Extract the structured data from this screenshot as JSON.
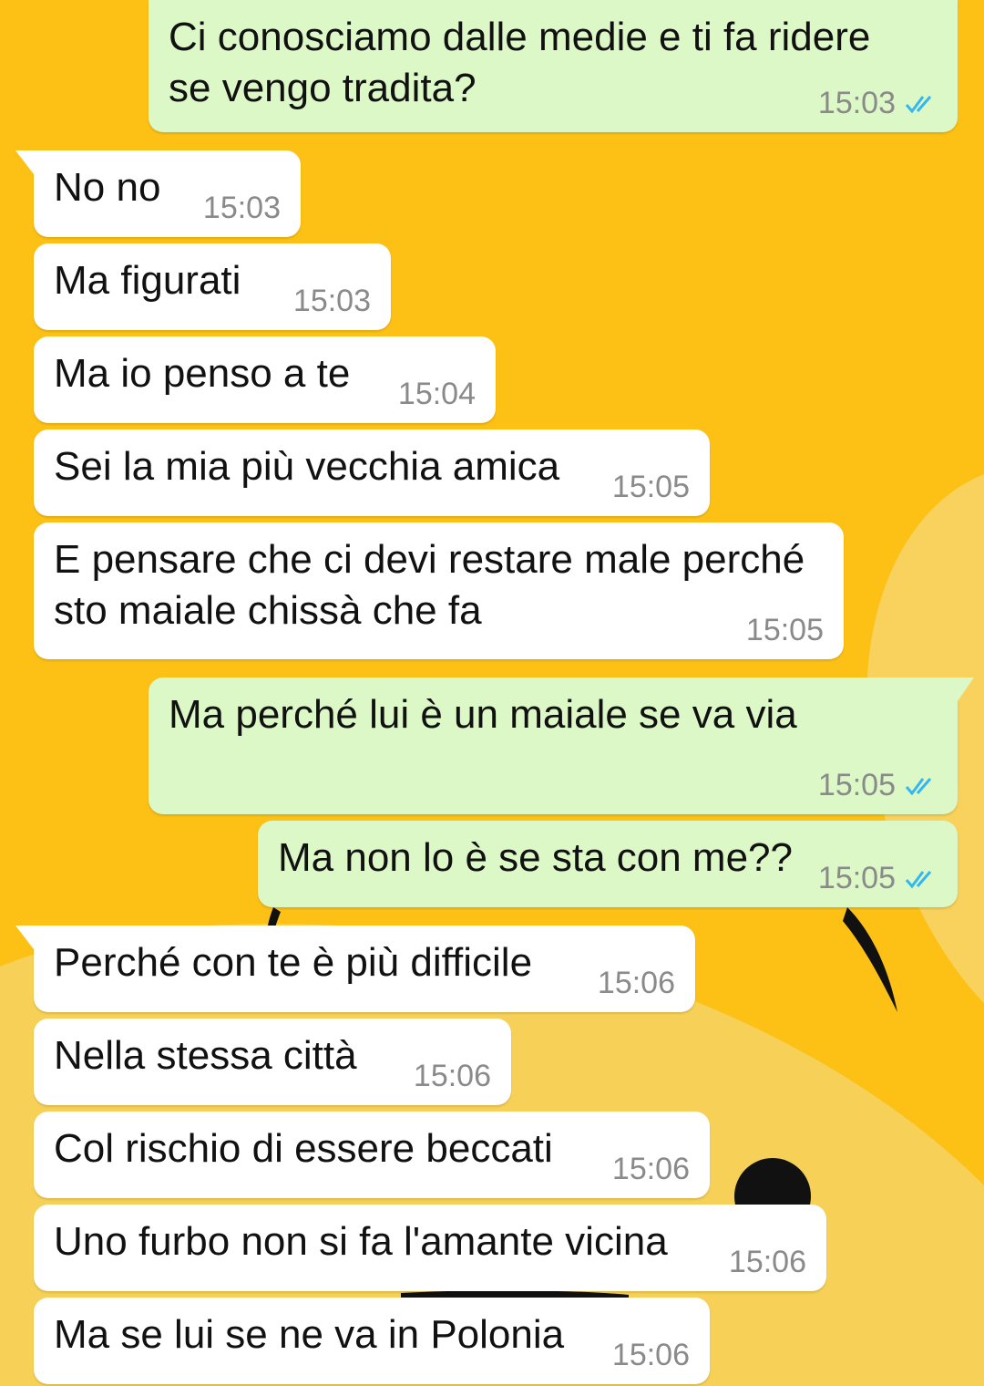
{
  "theme": {
    "wallpaper_color": "#FDC116",
    "wallpaper_light_color": "#F8D25C",
    "incoming_bubble_color": "#FFFFFF",
    "outgoing_bubble_color": "#DCF8C6",
    "timestamp_color": "#8A8A8A",
    "read_receipt_color": "#34B7F1"
  },
  "messages": [
    {
      "direction": "outgoing",
      "text": "Ci conosciamo dalle medie e ti fa ridere\nse vengo tradita?",
      "time": "15:03",
      "status_icon": "double-check-read-icon"
    },
    {
      "direction": "incoming",
      "text": "No no",
      "time": "15:03"
    },
    {
      "direction": "incoming",
      "text": "Ma figurati",
      "time": "15:03"
    },
    {
      "direction": "incoming",
      "text": "Ma io penso a te",
      "time": "15:04"
    },
    {
      "direction": "incoming",
      "text": "Sei la mia più vecchia amica",
      "time": "15:05"
    },
    {
      "direction": "incoming",
      "text": "E pensare che ci devi restare male perché\nsto maiale chissà che fa",
      "time": "15:05"
    },
    {
      "direction": "outgoing",
      "text": "Ma perché lui è un maiale se va via",
      "time": "15:05",
      "status_icon": "double-check-read-icon"
    },
    {
      "direction": "outgoing",
      "text": "Ma non lo è se sta con me??",
      "time": "15:05",
      "status_icon": "double-check-read-icon"
    },
    {
      "direction": "incoming",
      "text": "Perché con te è più difficile",
      "time": "15:06"
    },
    {
      "direction": "incoming",
      "text": "Nella stessa città",
      "time": "15:06"
    },
    {
      "direction": "incoming",
      "text": "Col rischio di essere beccati",
      "time": "15:06"
    },
    {
      "direction": "incoming",
      "text": "Uno furbo non si fa l'amante vicina",
      "time": "15:06"
    },
    {
      "direction": "incoming",
      "text": "Ma se lui se ne va in Polonia",
      "time": "15:06"
    }
  ]
}
